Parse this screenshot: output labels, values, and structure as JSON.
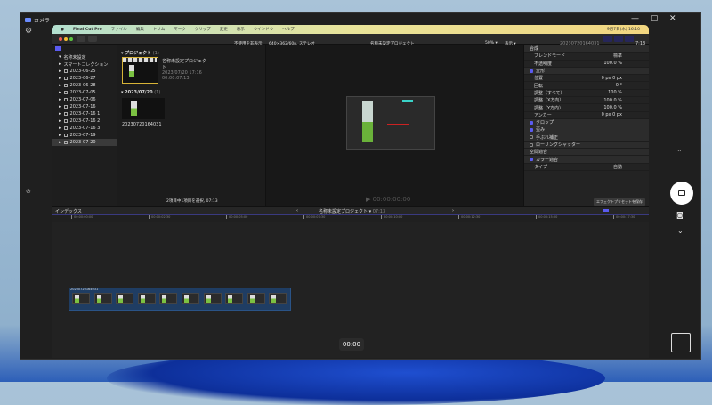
{
  "camera": {
    "title": "カメラ",
    "timecode": "00:00",
    "minimize": "—",
    "maximize": "▢",
    "close": "✕"
  },
  "fcp": {
    "menu": [
      "Final Cut Pro",
      "ファイル",
      "編集",
      "トリム",
      "マーク",
      "クリップ",
      "変更",
      "表示",
      "ウインドウ",
      "ヘルプ"
    ],
    "clock": "9月7日(木) 16:10",
    "browser_filter": "不使用を非表示",
    "format": "640×362/60p, ステレオ",
    "library": "名称未設定",
    "sidebar": [
      "スマートコレクション",
      "2023-06-25",
      "2023-06-27",
      "2023-06-28",
      "2023-07-05",
      "2023-07-06",
      "2023-07-16",
      "2023-07-16 1",
      "2023-07-16 2",
      "2023-07-16 3",
      "2023-07-19",
      "2023-07-20"
    ],
    "projects_header": "プロジェクト",
    "projects_count": "(1)",
    "project": {
      "name": "名称未設定プロジェクト",
      "date": "2023/07/20 17:16",
      "duration": "00:00:07:13"
    },
    "event_header": "2023/07/20",
    "event_count": "(1)",
    "clip_name": "20230720164031",
    "selection_status": "2項目中1項目を選択, 07:13",
    "viewer_title": "名称未設定プロジェクト",
    "zoom": "50%",
    "view": "表示",
    "viewer_tc": "00:00:00:00",
    "inspector": {
      "clip": "20230720164031",
      "duration": "7:13",
      "rows": [
        {
          "label": "合成",
          "type": "sec"
        },
        {
          "label": "ブレンドモード",
          "value": "標準"
        },
        {
          "label": "不透明度",
          "value": "100.0 %"
        },
        {
          "label": "変形",
          "type": "check"
        },
        {
          "label": "位置",
          "value": "0 px   0 px"
        },
        {
          "label": "回転",
          "value": "0 °"
        },
        {
          "label": "調整（すべて）",
          "value": "100 %"
        },
        {
          "label": "調整（X方向）",
          "value": "100.0 %"
        },
        {
          "label": "調整（Y方向）",
          "value": "100.0 %"
        },
        {
          "label": "アンカー",
          "value": "0 px   0 px"
        },
        {
          "label": "クロップ",
          "type": "check"
        },
        {
          "label": "歪み",
          "type": "check"
        },
        {
          "label": "手ぶれ補正",
          "type": "uncheck"
        },
        {
          "label": "ローリングシャッター",
          "type": "uncheck"
        },
        {
          "label": "空間適合",
          "type": "sec"
        },
        {
          "label": "カラー適合",
          "type": "check"
        },
        {
          "label": "タイプ",
          "value": "自動"
        }
      ],
      "save_preset": "エフェクトプリセットを保存"
    },
    "index": "インデックス",
    "timeline_title": "名称未設定プロジェクト",
    "timeline_dur": "07:13",
    "ruler": [
      "00:00:00:00",
      "00:00:02:30",
      "00:00:05:00",
      "00:00:07:30",
      "00:00:10:00",
      "00:00:12:30",
      "00:00:15:00",
      "00:00:17:30"
    ],
    "timeline_clip": "20230720164031"
  }
}
